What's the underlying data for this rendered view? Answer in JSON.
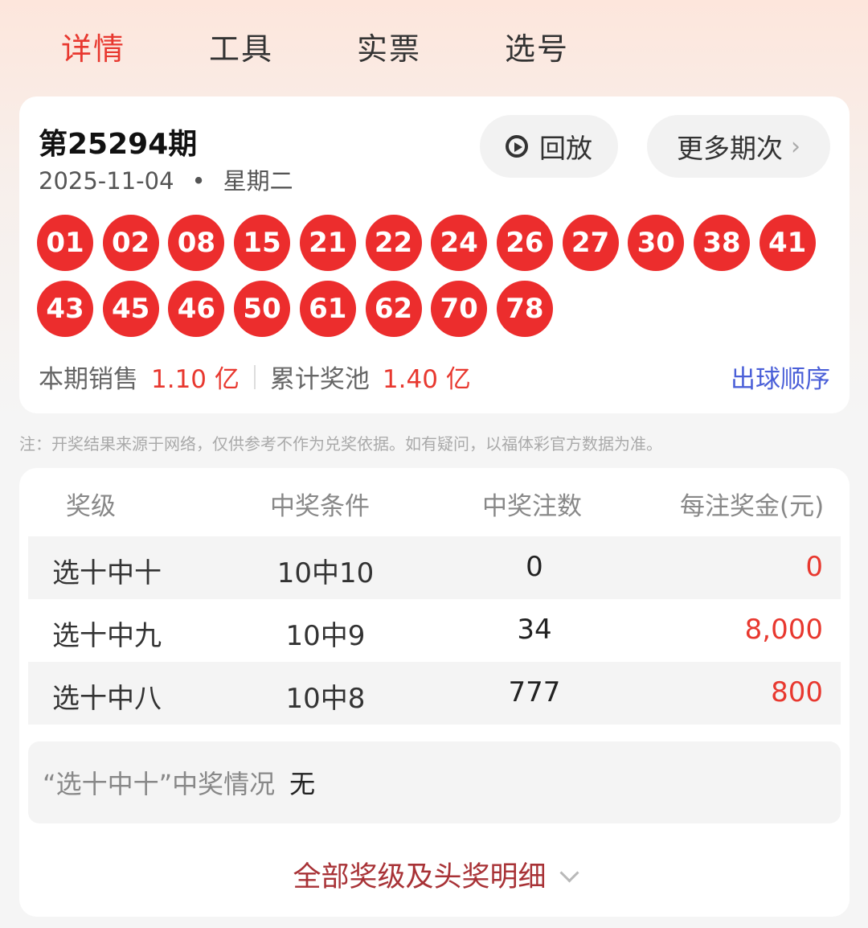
{
  "tabs": [
    "详情",
    "工具",
    "实票",
    "选号"
  ],
  "draw": {
    "issue": "第25294期",
    "date": "2025-11-04",
    "weekday": "星期二",
    "replay_label": "回放",
    "more_label": "更多期次",
    "numbers": [
      "01",
      "02",
      "08",
      "15",
      "21",
      "22",
      "24",
      "26",
      "27",
      "30",
      "38",
      "41",
      "43",
      "45",
      "46",
      "50",
      "61",
      "62",
      "70",
      "78"
    ],
    "sales_label": "本期销售",
    "sales_value": "1.10 亿",
    "pool_label": "累计奖池",
    "pool_value": "1.40 亿",
    "order_link": "出球顺序"
  },
  "note": "注：开奖结果来源于网络，仅供参考不作为兑奖依据。如有疑问，以福体彩官方数据为准。",
  "prize_table": {
    "headers": [
      "奖级",
      "中奖条件",
      "中奖注数",
      "每注奖金(元)"
    ],
    "rows": [
      {
        "level": "选十中十",
        "condition": "10中10",
        "count": "0",
        "amount": "0"
      },
      {
        "level": "选十中九",
        "condition": "10中9",
        "count": "34",
        "amount": "8,000"
      },
      {
        "level": "选十中八",
        "condition": "10中8",
        "count": "777",
        "amount": "800"
      }
    ]
  },
  "top_prize": {
    "label": "“选十中十”中奖情况",
    "value": "无"
  },
  "expand_label": "全部奖级及头奖明细",
  "colors": {
    "accent": "#e8382f",
    "ball": "#ec2d2d",
    "link": "#4a5fd8"
  }
}
